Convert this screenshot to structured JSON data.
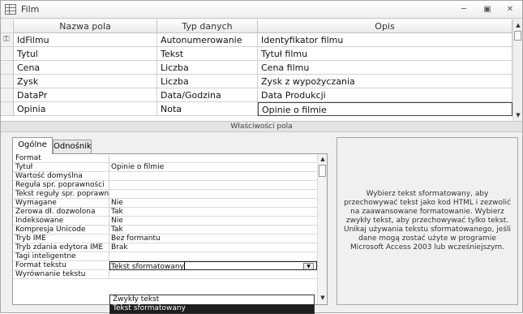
{
  "window": {
    "title": "Film"
  },
  "grid": {
    "headers": [
      "Nazwa pola",
      "Typ danych",
      "Opis"
    ],
    "rows": [
      {
        "name": "IdFilmu",
        "type": "Autonumerowanie",
        "desc": "Identyfikator filmu",
        "key": true
      },
      {
        "name": "Tytul",
        "type": "Tekst",
        "desc": "Tytuł filmu"
      },
      {
        "name": "Cena",
        "type": "Liczba",
        "desc": "Cena filmu"
      },
      {
        "name": "Zysk",
        "type": "Liczba",
        "desc": "Zysk z wypożyczania"
      },
      {
        "name": "DataPr",
        "type": "Data/Godzina",
        "desc": "Data Produkcji"
      },
      {
        "name": "Opinia",
        "type": "Nota",
        "desc": "Opinie o filmie",
        "selected": true
      }
    ]
  },
  "props_header": "Właściwości pola",
  "tabs": {
    "general": "Ogólne",
    "lookup": "Odnośnik"
  },
  "properties": [
    {
      "label": "Format",
      "value": ""
    },
    {
      "label": "Tytuł",
      "value": "Opinie o filmie"
    },
    {
      "label": "Wartość domyślna",
      "value": ""
    },
    {
      "label": "Reguła spr. poprawności",
      "value": ""
    },
    {
      "label": "Tekst reguły spr. poprawności",
      "value": ""
    },
    {
      "label": "Wymagane",
      "value": "Nie"
    },
    {
      "label": "Zerowa dł. dozwolona",
      "value": "Tak"
    },
    {
      "label": "Indeksowane",
      "value": "Nie"
    },
    {
      "label": "Kompresja Unicode",
      "value": "Tak"
    },
    {
      "label": "Tryb IME",
      "value": "Bez formantu"
    },
    {
      "label": "Tryb zdania edytora IME",
      "value": "Brak"
    },
    {
      "label": "Tagi inteligentne",
      "value": ""
    },
    {
      "label": "Format tekstu",
      "value": "Tekst sformatowany"
    },
    {
      "label": "Wyrównanie tekstu",
      "value": ""
    }
  ],
  "dropdown": {
    "options": [
      "Zwykły tekst",
      "Tekst sformatowany"
    ],
    "selected_index": 1
  },
  "help_text": "Wybierz tekst sformatowany, aby przechowywać tekst jako kod HTML i zezwolić na zaawansowane formatowanie. Wybierz zwykły tekst, aby przechowywać tylko tekst. Unikaj używania tekstu sformatowanego, jeśli dane mogą zostać użyte w programie Microsoft Access 2003 lub wcześniejszym."
}
